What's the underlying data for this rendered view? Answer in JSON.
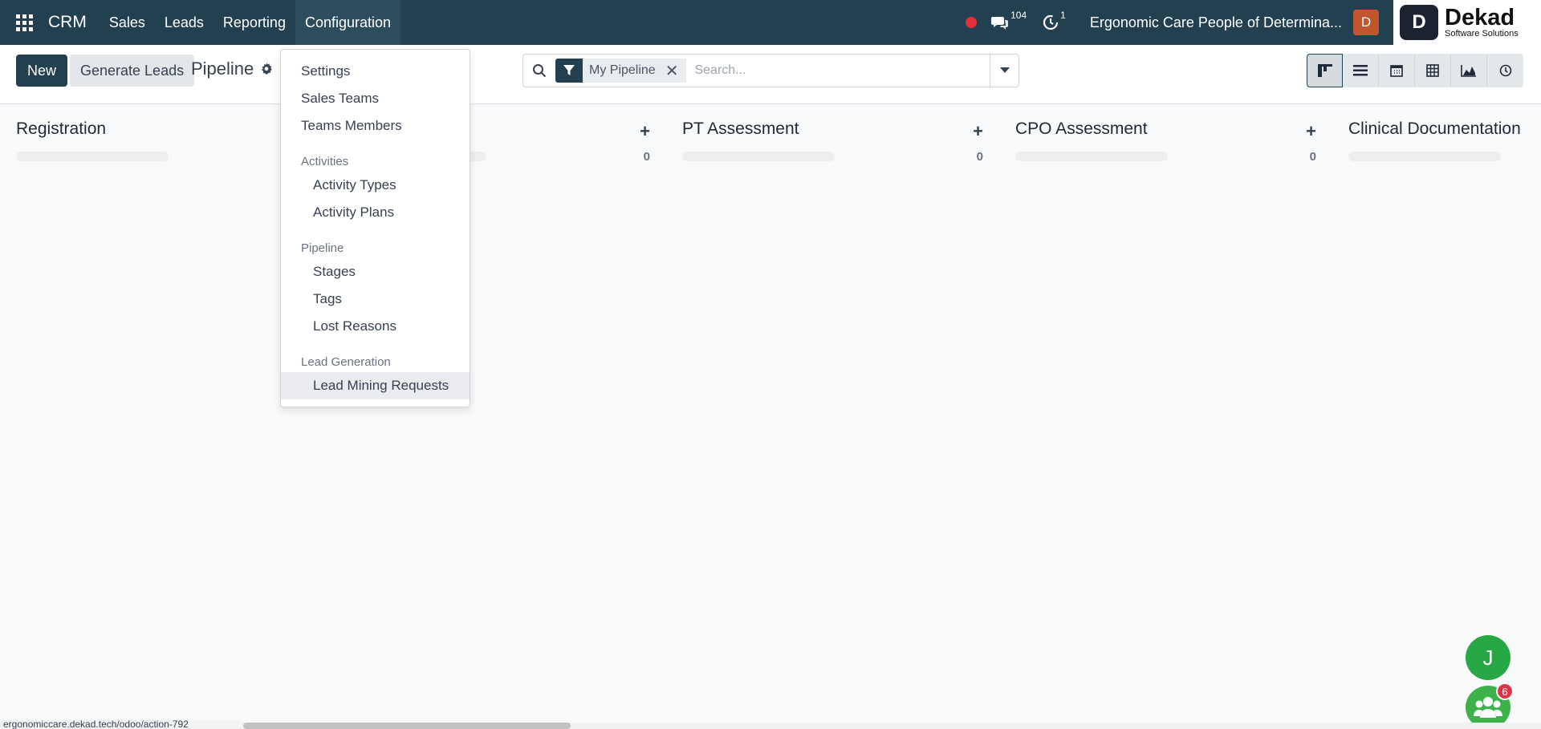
{
  "navbar": {
    "brand": "CRM",
    "menu": [
      "Sales",
      "Leads",
      "Reporting",
      "Configuration"
    ],
    "messages_count": "104",
    "activities_count": "1",
    "company": "Ergonomic Care People of Determina...",
    "user_initial": "D",
    "logo": {
      "mark": "D",
      "name": "Dekad",
      "subtitle": "Software Solutions"
    }
  },
  "control": {
    "new_label": "New",
    "generate_label": "Generate Leads",
    "breadcrumb": "Pipeline",
    "facet_label": "My Pipeline",
    "search_placeholder": "Search...",
    "views": [
      "kanban-icon",
      "list-icon",
      "calendar-icon",
      "pivot-icon",
      "graph-icon",
      "activity-icon"
    ]
  },
  "kanban": {
    "columns": [
      {
        "title": "Registration",
        "count": ""
      },
      {
        "title": "",
        "count": "0"
      },
      {
        "title": "PT Assessment",
        "count": "0"
      },
      {
        "title": "CPO Assessment",
        "count": "0"
      },
      {
        "title": "Clinical Documentation",
        "count": ""
      }
    ]
  },
  "dropdown": {
    "items": [
      {
        "type": "item",
        "label": "Settings"
      },
      {
        "type": "item",
        "label": "Sales Teams"
      },
      {
        "type": "item",
        "label": "Teams Members"
      },
      {
        "type": "header",
        "label": "Activities"
      },
      {
        "type": "sub",
        "label": "Activity Types"
      },
      {
        "type": "sub",
        "label": "Activity Plans"
      },
      {
        "type": "header",
        "label": "Pipeline"
      },
      {
        "type": "sub",
        "label": "Stages"
      },
      {
        "type": "sub",
        "label": "Tags"
      },
      {
        "type": "sub",
        "label": "Lost Reasons"
      },
      {
        "type": "header",
        "label": "Lead Generation"
      },
      {
        "type": "sub",
        "label": "Lead Mining Requests"
      }
    ]
  },
  "floating": {
    "user_initial": "J",
    "chat_badge": "6"
  },
  "status_url": "ergonomiccare.dekad.tech/odoo/action-792"
}
